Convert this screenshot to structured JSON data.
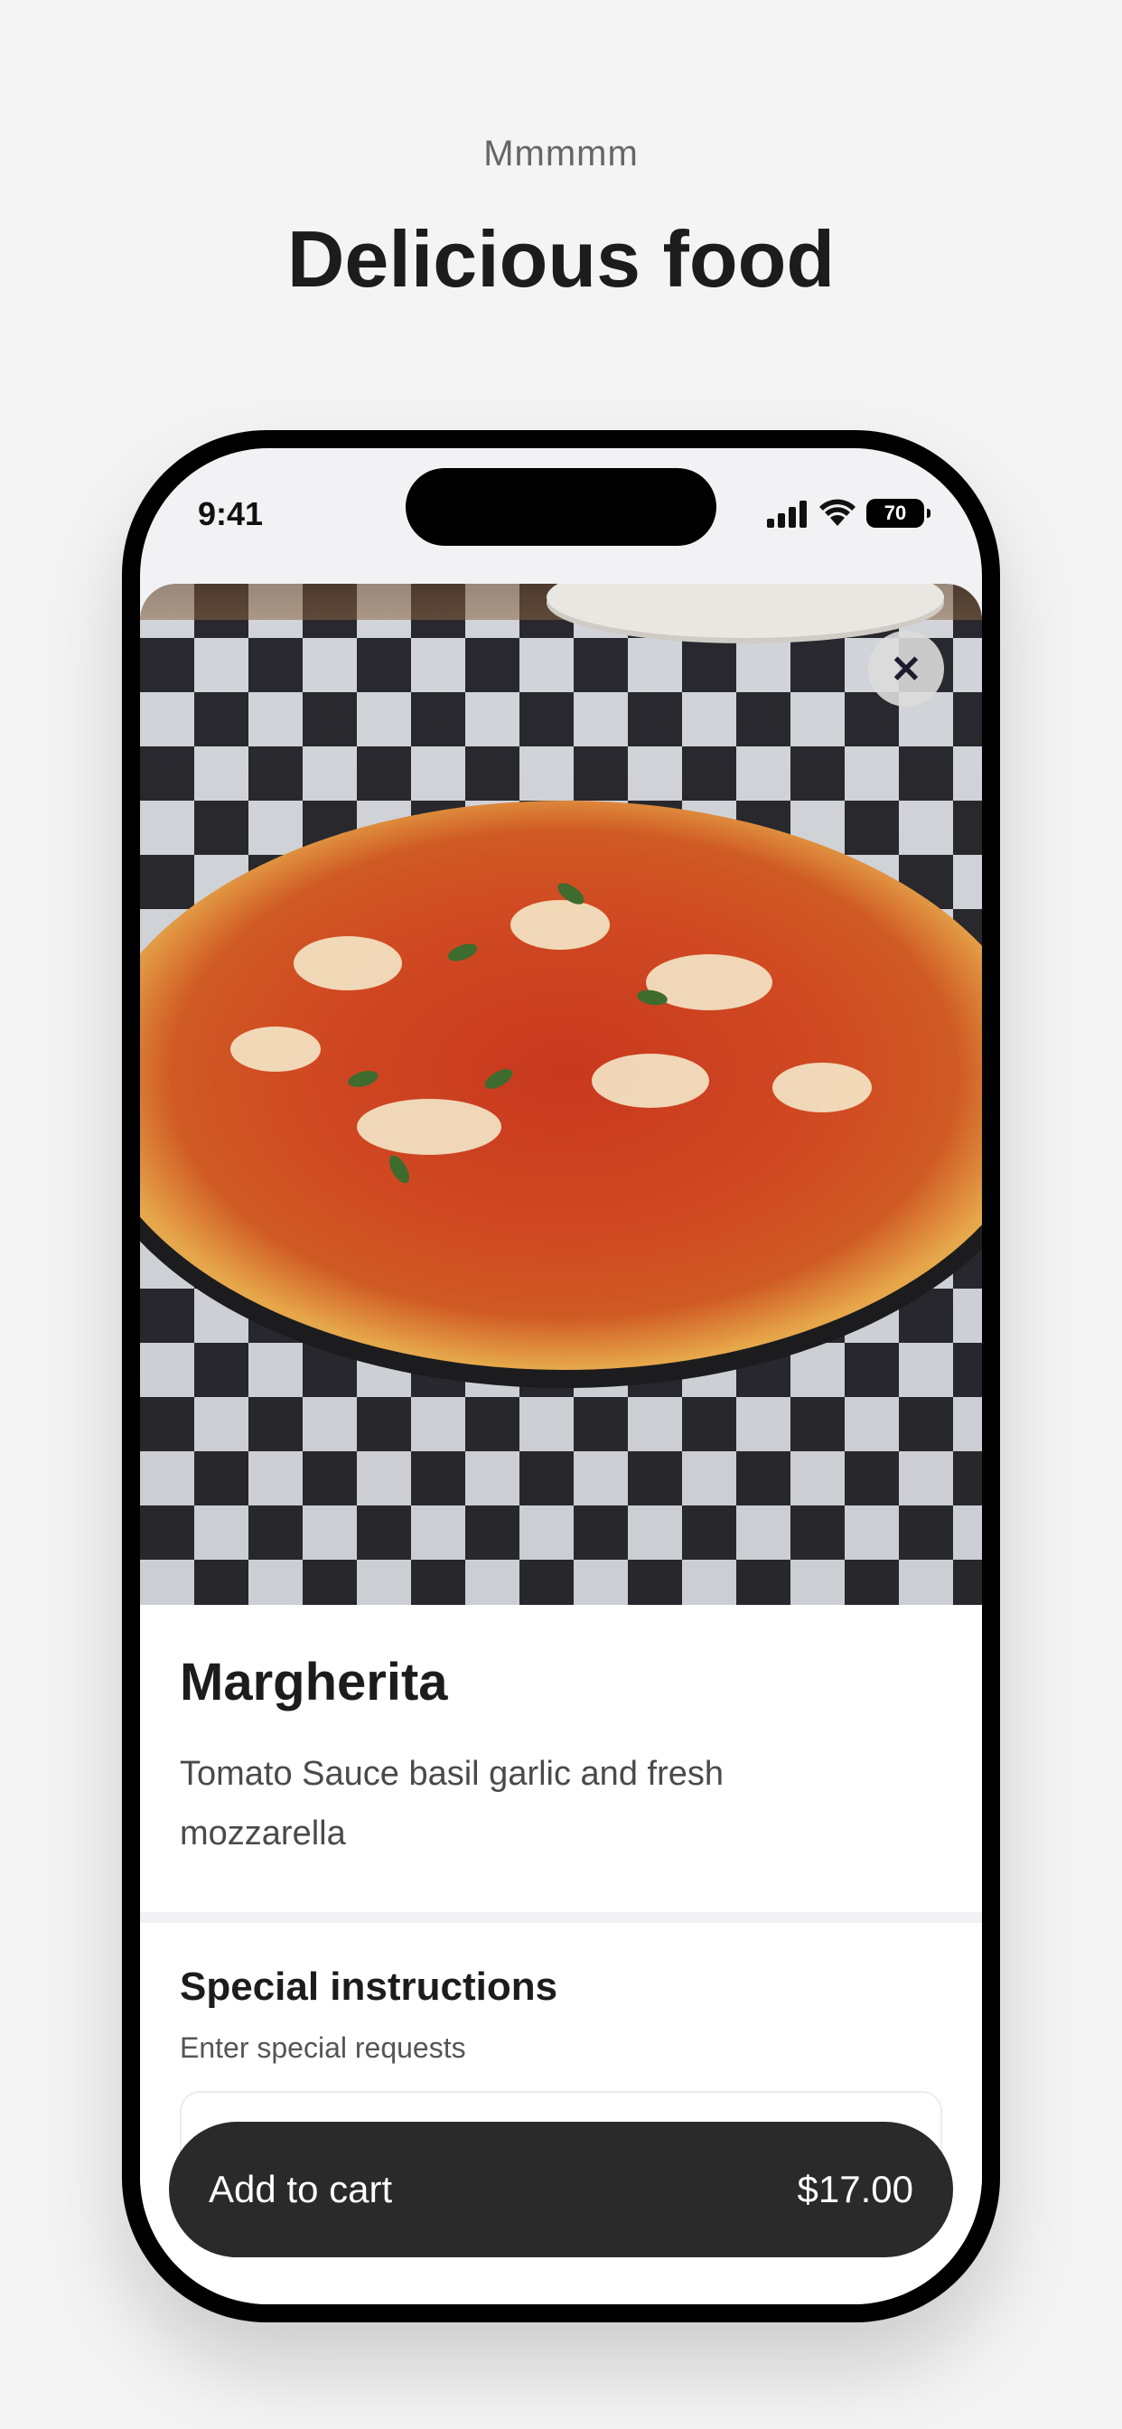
{
  "header": {
    "eyebrow": "Mmmmm",
    "title": "Delicious food"
  },
  "status_bar": {
    "time": "9:41",
    "battery": "70"
  },
  "product": {
    "name": "Margherita",
    "description": "Tomato Sauce basil garlic and fresh mozzarella",
    "close_icon": "close-icon"
  },
  "instructions": {
    "title": "Special instructions",
    "subtitle": "Enter special requests",
    "value": ""
  },
  "cart": {
    "label": "Add to cart",
    "price": "$17.00"
  },
  "colors": {
    "background": "#f4f4f4",
    "button": "#2a2a2a",
    "text": "#1c1c1c"
  }
}
